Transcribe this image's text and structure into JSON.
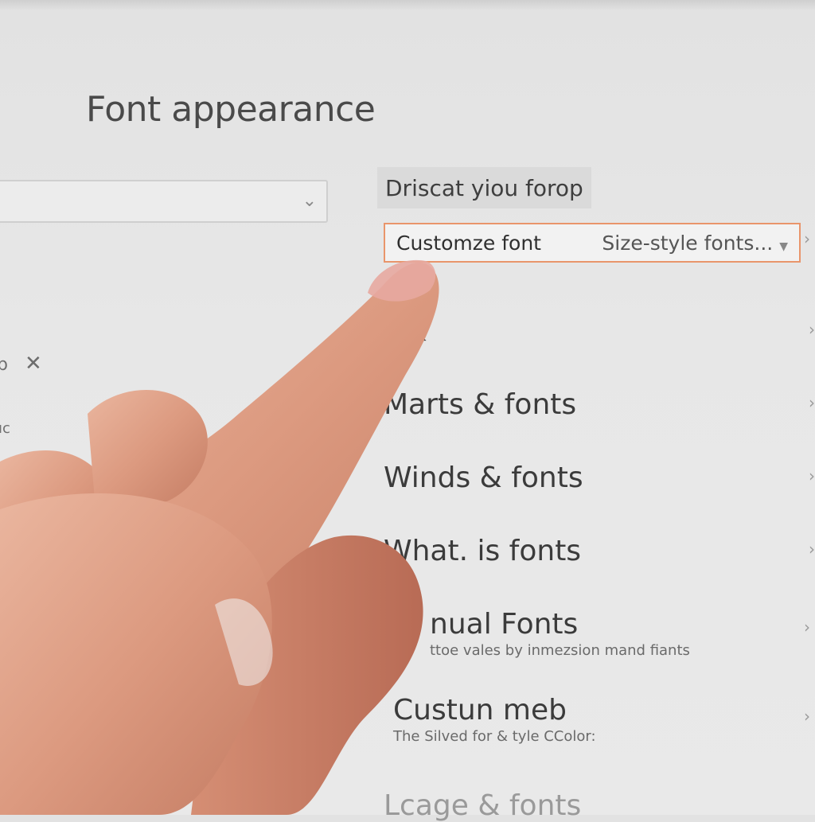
{
  "page": {
    "title": "Font appearance"
  },
  "section": {
    "label": "Driscat yiou forop"
  },
  "customize": {
    "label": "Customze font",
    "value": "Size-style fonts..."
  },
  "left_panel": {
    "fragment_1": "p",
    "fragment_2": "ıc"
  },
  "menu": {
    "items": [
      {
        "name": "ınk",
        "subtitle": ""
      },
      {
        "name": "Marts & fonts",
        "subtitle": ""
      },
      {
        "name": "Winds & fonts",
        "subtitle": ""
      },
      {
        "name": "What. is fonts",
        "subtitle": ""
      },
      {
        "name": "nual Fonts",
        "subtitle": "ttoe vales by inmezsion mand fiants"
      },
      {
        "name": "Custun meb",
        "subtitle": "The Silved for & tyle CColor:"
      },
      {
        "name": "Lcage & fonts",
        "subtitle": ""
      }
    ]
  },
  "colors": {
    "focus_border": "#e9956b",
    "background": "#e6e6e6",
    "skin": "#e0a38c"
  },
  "icons": {
    "chevron": "chevron-down-icon",
    "close": "close-icon",
    "arrow": "chevron-right-icon"
  }
}
